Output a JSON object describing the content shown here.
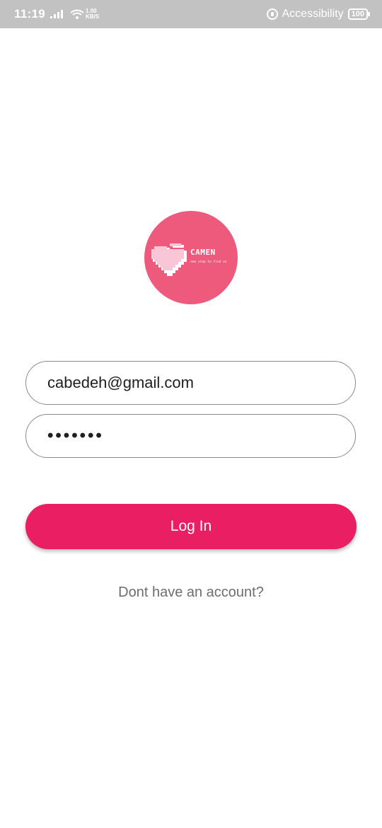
{
  "status_bar": {
    "time": "11:19",
    "net_speed_value": "1.00",
    "net_speed_unit": "KB/S",
    "accessibility_label": "Accessibility",
    "battery": "100"
  },
  "logo": {
    "title": "CAMEN",
    "tagline": "one step to find us",
    "background_color": "#ee5a7c",
    "icon": "pixel-heart-icon"
  },
  "login_form": {
    "email_value": "cabedeh@gmail.com",
    "password_value": "•••••••",
    "submit_label": "Log In",
    "signup_prompt": "Dont have an account?"
  },
  "colors": {
    "accent": "#e91e63",
    "status_bar": "#c2c2c2",
    "field_border": "#8a8a8a",
    "link_text": "#6d6d6d"
  }
}
